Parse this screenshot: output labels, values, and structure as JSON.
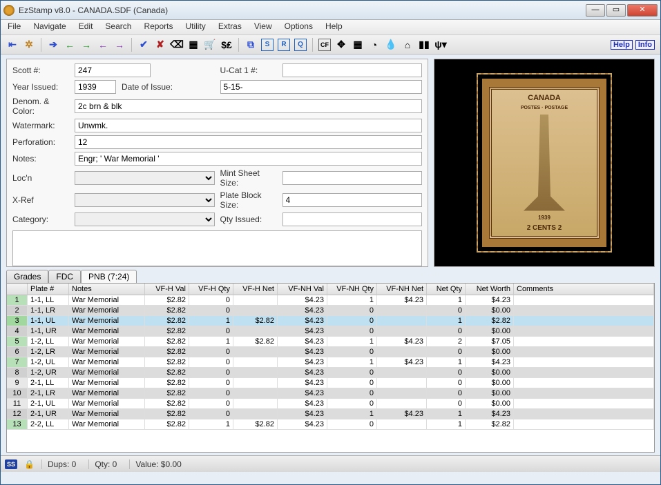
{
  "window": {
    "title": "EzStamp v8.0 - CANADA.SDF (Canada)"
  },
  "menu": [
    "File",
    "Navigate",
    "Edit",
    "Search",
    "Reports",
    "Utility",
    "Extras",
    "View",
    "Options",
    "Help"
  ],
  "help_buttons": [
    "Help",
    "Info"
  ],
  "form": {
    "scott_label": "Scott #:",
    "scott": "247",
    "ucat_label": "U-Cat 1 #:",
    "ucat": "",
    "year_label": "Year Issued:",
    "year": "1939",
    "doi_label": "Date of Issue:",
    "doi": "5-15-",
    "denom_label": "Denom. & Color:",
    "denom": "2c brn & blk",
    "wmk_label": "Watermark:",
    "wmk": "Unwmk.",
    "perf_label": "Perforation:",
    "perf": "12",
    "notes_label": "Notes:",
    "notes": "Engr; ' War Memorial '",
    "loc_label": "Loc'n",
    "loc": "",
    "mint_label": "Mint Sheet Size:",
    "mint": "",
    "xref_label": "X-Ref",
    "xref": "",
    "pbs_label": "Plate Block Size:",
    "pbs": "4",
    "cat_label": "Category:",
    "cat": "",
    "qty_label": "Qty Issued:",
    "qty": ""
  },
  "stamp": {
    "top": "CANADA",
    "band": "POSTES · POSTAGE",
    "year": "1939",
    "denom": "2       CENTS       2"
  },
  "tabs": {
    "grades": "Grades",
    "fdc": "FDC",
    "pnb": "PNB (7:24)"
  },
  "grid": {
    "headers": [
      "",
      "Plate #",
      "Notes",
      "VF-H Val",
      "VF-H Qty",
      "VF-H Net",
      "VF-NH Val",
      "VF-NH Qty",
      "VF-NH Net",
      "Net Qty",
      "Net Worth",
      "Comments"
    ],
    "rows": [
      {
        "n": "1",
        "plate": "1-1, LL",
        "notes": "War Memorial",
        "hv": "$2.82",
        "hq": "0",
        "hn": "",
        "nhv": "$4.23",
        "nhq": "1",
        "nhn": "$4.23",
        "nq": "1",
        "nw": "$4.23",
        "c": "",
        "green": true
      },
      {
        "n": "2",
        "plate": "1-1, LR",
        "notes": "War Memorial",
        "hv": "$2.82",
        "hq": "0",
        "hn": "",
        "nhv": "$4.23",
        "nhq": "0",
        "nhn": "",
        "nq": "0",
        "nw": "$0.00",
        "c": ""
      },
      {
        "n": "3",
        "plate": "1-1, UL",
        "notes": "War Memorial",
        "hv": "$2.82",
        "hq": "1",
        "hn": "$2.82",
        "nhv": "$4.23",
        "nhq": "0",
        "nhn": "",
        "nq": "1",
        "nw": "$2.82",
        "c": "",
        "sel": true,
        "green": true
      },
      {
        "n": "4",
        "plate": "1-1, UR",
        "notes": "War Memorial",
        "hv": "$2.82",
        "hq": "0",
        "hn": "",
        "nhv": "$4.23",
        "nhq": "0",
        "nhn": "",
        "nq": "0",
        "nw": "$0.00",
        "c": ""
      },
      {
        "n": "5",
        "plate": "1-2, LL",
        "notes": "War Memorial",
        "hv": "$2.82",
        "hq": "1",
        "hn": "$2.82",
        "nhv": "$4.23",
        "nhq": "1",
        "nhn": "$4.23",
        "nq": "2",
        "nw": "$7.05",
        "c": "",
        "green": true
      },
      {
        "n": "6",
        "plate": "1-2, LR",
        "notes": "War Memorial",
        "hv": "$2.82",
        "hq": "0",
        "hn": "",
        "nhv": "$4.23",
        "nhq": "0",
        "nhn": "",
        "nq": "0",
        "nw": "$0.00",
        "c": ""
      },
      {
        "n": "7",
        "plate": "1-2, UL",
        "notes": "War Memorial",
        "hv": "$2.82",
        "hq": "0",
        "hn": "",
        "nhv": "$4.23",
        "nhq": "1",
        "nhn": "$4.23",
        "nq": "1",
        "nw": "$4.23",
        "c": "",
        "green": true
      },
      {
        "n": "8",
        "plate": "1-2, UR",
        "notes": "War Memorial",
        "hv": "$2.82",
        "hq": "0",
        "hn": "",
        "nhv": "$4.23",
        "nhq": "0",
        "nhn": "",
        "nq": "0",
        "nw": "$0.00",
        "c": ""
      },
      {
        "n": "9",
        "plate": "2-1, LL",
        "notes": "War Memorial",
        "hv": "$2.82",
        "hq": "0",
        "hn": "",
        "nhv": "$4.23",
        "nhq": "0",
        "nhn": "",
        "nq": "0",
        "nw": "$0.00",
        "c": ""
      },
      {
        "n": "10",
        "plate": "2-1, LR",
        "notes": "War Memorial",
        "hv": "$2.82",
        "hq": "0",
        "hn": "",
        "nhv": "$4.23",
        "nhq": "0",
        "nhn": "",
        "nq": "0",
        "nw": "$0.00",
        "c": ""
      },
      {
        "n": "11",
        "plate": "2-1, UL",
        "notes": "War Memorial",
        "hv": "$2.82",
        "hq": "0",
        "hn": "",
        "nhv": "$4.23",
        "nhq": "0",
        "nhn": "",
        "nq": "0",
        "nw": "$0.00",
        "c": ""
      },
      {
        "n": "12",
        "plate": "2-1, UR",
        "notes": "War Memorial",
        "hv": "$2.82",
        "hq": "0",
        "hn": "",
        "nhv": "$4.23",
        "nhq": "1",
        "nhn": "$4.23",
        "nq": "1",
        "nw": "$4.23",
        "c": "",
        "green": true
      },
      {
        "n": "13",
        "plate": "2-2, LL",
        "notes": "War Memorial",
        "hv": "$2.82",
        "hq": "1",
        "hn": "$2.82",
        "nhv": "$4.23",
        "nhq": "0",
        "nhn": "",
        "nq": "1",
        "nw": "$2.82",
        "c": "",
        "green": true
      }
    ]
  },
  "status": {
    "dups": "Dups: 0",
    "qty": "Qty: 0",
    "value": "Value: $0.00"
  }
}
